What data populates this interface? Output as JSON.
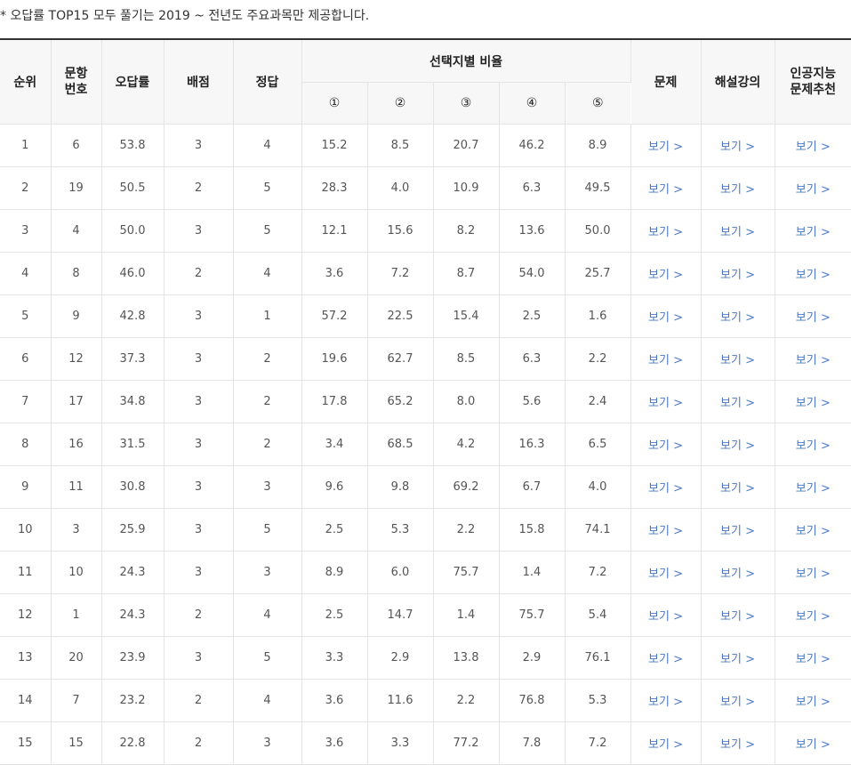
{
  "note": "* 오답률 TOP15 모두 풀기는 2019 ~ 전년도 주요과목만 제공합니다.",
  "headers": {
    "rank": "순위",
    "question_no": "문항\n번호",
    "wrong_rate": "오답률",
    "score": "배점",
    "answer": "정답",
    "choice_ratio": "선택지별 비율",
    "choices": [
      "①",
      "②",
      "③",
      "④",
      "⑤"
    ],
    "problem": "문제",
    "lecture": "해설강의",
    "ai": "인공지능\n문제추천"
  },
  "link_label": "보기 >",
  "rows": [
    {
      "rank": "1",
      "no": "6",
      "rate": "53.8",
      "score": "3",
      "ans": "4",
      "c": [
        "15.2",
        "8.5",
        "20.7",
        "46.2",
        "8.9"
      ]
    },
    {
      "rank": "2",
      "no": "19",
      "rate": "50.5",
      "score": "2",
      "ans": "5",
      "c": [
        "28.3",
        "4.0",
        "10.9",
        "6.3",
        "49.5"
      ]
    },
    {
      "rank": "3",
      "no": "4",
      "rate": "50.0",
      "score": "3",
      "ans": "5",
      "c": [
        "12.1",
        "15.6",
        "8.2",
        "13.6",
        "50.0"
      ]
    },
    {
      "rank": "4",
      "no": "8",
      "rate": "46.0",
      "score": "2",
      "ans": "4",
      "c": [
        "3.6",
        "7.2",
        "8.7",
        "54.0",
        "25.7"
      ]
    },
    {
      "rank": "5",
      "no": "9",
      "rate": "42.8",
      "score": "3",
      "ans": "1",
      "c": [
        "57.2",
        "22.5",
        "15.4",
        "2.5",
        "1.6"
      ]
    },
    {
      "rank": "6",
      "no": "12",
      "rate": "37.3",
      "score": "3",
      "ans": "2",
      "c": [
        "19.6",
        "62.7",
        "8.5",
        "6.3",
        "2.2"
      ]
    },
    {
      "rank": "7",
      "no": "17",
      "rate": "34.8",
      "score": "3",
      "ans": "2",
      "c": [
        "17.8",
        "65.2",
        "8.0",
        "5.6",
        "2.4"
      ]
    },
    {
      "rank": "8",
      "no": "16",
      "rate": "31.5",
      "score": "3",
      "ans": "2",
      "c": [
        "3.4",
        "68.5",
        "4.2",
        "16.3",
        "6.5"
      ]
    },
    {
      "rank": "9",
      "no": "11",
      "rate": "30.8",
      "score": "3",
      "ans": "3",
      "c": [
        "9.6",
        "9.8",
        "69.2",
        "6.7",
        "4.0"
      ]
    },
    {
      "rank": "10",
      "no": "3",
      "rate": "25.9",
      "score": "3",
      "ans": "5",
      "c": [
        "2.5",
        "5.3",
        "2.2",
        "15.8",
        "74.1"
      ]
    },
    {
      "rank": "11",
      "no": "10",
      "rate": "24.3",
      "score": "3",
      "ans": "3",
      "c": [
        "8.9",
        "6.0",
        "75.7",
        "1.4",
        "7.2"
      ]
    },
    {
      "rank": "12",
      "no": "1",
      "rate": "24.3",
      "score": "2",
      "ans": "4",
      "c": [
        "2.5",
        "14.7",
        "1.4",
        "75.7",
        "5.4"
      ]
    },
    {
      "rank": "13",
      "no": "20",
      "rate": "23.9",
      "score": "3",
      "ans": "5",
      "c": [
        "3.3",
        "2.9",
        "13.8",
        "2.9",
        "76.1"
      ]
    },
    {
      "rank": "14",
      "no": "7",
      "rate": "23.2",
      "score": "2",
      "ans": "4",
      "c": [
        "3.6",
        "11.6",
        "2.2",
        "76.8",
        "5.3"
      ]
    },
    {
      "rank": "15",
      "no": "15",
      "rate": "22.8",
      "score": "2",
      "ans": "3",
      "c": [
        "3.6",
        "3.3",
        "77.2",
        "7.8",
        "7.2"
      ]
    }
  ]
}
